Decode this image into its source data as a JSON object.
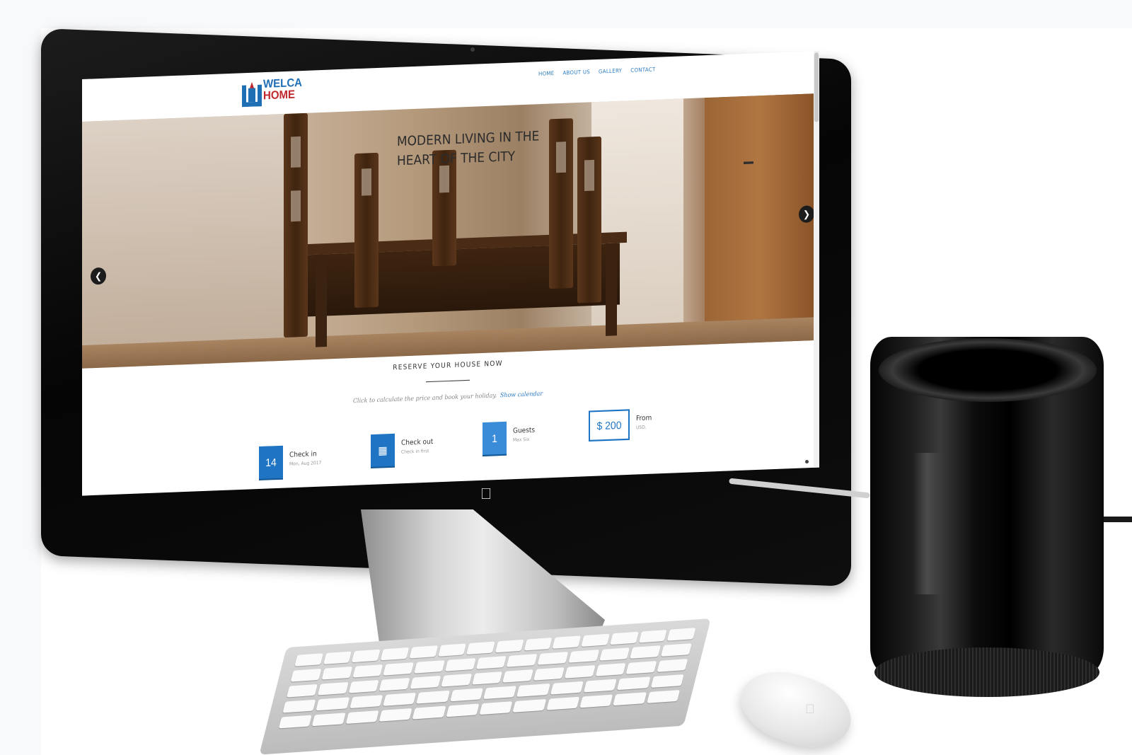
{
  "site": {
    "logo": {
      "line1": "WELCA",
      "line2": "HOME",
      "mark_color": "#1f6fb5",
      "accent_color": "#c0282d"
    },
    "nav": [
      {
        "label": "HOME"
      },
      {
        "label": "ABOUT US"
      },
      {
        "label": "GALLERY"
      },
      {
        "label": "CONTACT"
      }
    ],
    "hero": {
      "title_line1": "MODERN LIVING IN THE",
      "title_line2": "HEART OF THE CITY",
      "prev_icon": "chevron-left-icon",
      "next_icon": "chevron-right-icon"
    },
    "reserve": {
      "title": "RESERVE YOUR HOUSE NOW",
      "subtitle": "Click to calculate the price and book your holiday.",
      "link": "Show calendar"
    },
    "booking": [
      {
        "box": "14",
        "label": "Check in",
        "sub": "Mon, Aug 2017"
      },
      {
        "box": "▦",
        "label": "Check out",
        "sub": "Check in first",
        "icon": "calendar-icon"
      },
      {
        "box": "1",
        "label": "Guests",
        "sub": "Max Six"
      },
      {
        "box": "$ 200",
        "label": "From",
        "sub": "USD."
      }
    ],
    "accent_color": "#1f75c4"
  },
  "device": {
    "monitor_logo_icon": "apple-logo-icon",
    "mouse_logo_icon": "apple-logo-icon"
  }
}
